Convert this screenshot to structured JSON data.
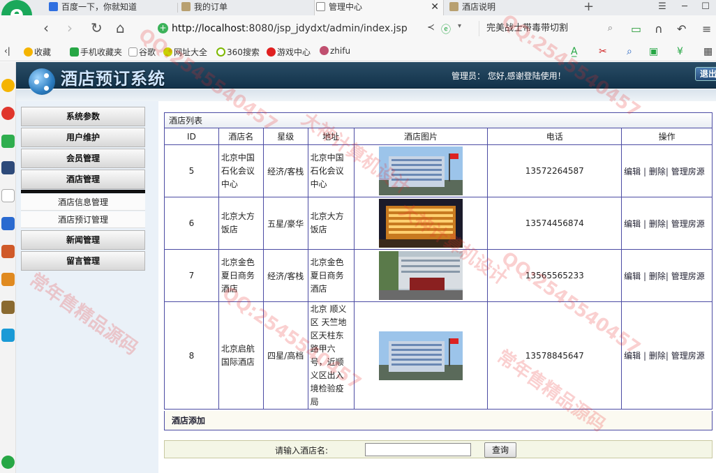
{
  "browser": {
    "tabs": [
      {
        "title": "百度一下，你就知道",
        "active": false
      },
      {
        "title": "我的订单",
        "active": false
      },
      {
        "title": "管理中心",
        "active": true
      },
      {
        "title": "酒店说明",
        "active": false
      }
    ],
    "url_host": "http://localhost",
    "url_rest": ":8080/jsp_jdydxt/admin/index.jsp",
    "search_text": "完美战士带毒带切割",
    "bookmarks": [
      "收藏",
      "手机收藏夹",
      "谷歌",
      "网址大全",
      "360搜索",
      "游戏中心",
      "zhifu"
    ]
  },
  "header": {
    "site_title": "酒店预订系统",
    "admin_msg": "管理员： 您好,感谢登陆使用！",
    "logout_label": "退出"
  },
  "menu": {
    "items": [
      "系统参数",
      "用户维护",
      "会员管理",
      "酒店管理",
      "新闻管理",
      "留言管理"
    ],
    "sub_items": [
      "酒店信息管理",
      "酒店预订管理"
    ]
  },
  "list": {
    "title": "酒店列表",
    "columns": [
      "ID",
      "酒店名",
      "星级",
      "地址",
      "酒店图片",
      "电话",
      "操作"
    ],
    "rows": [
      {
        "id": "5",
        "name": "北京中国石化会议中心",
        "star": "经济/客栈",
        "addr": "北京中国石化会议中心",
        "phone": "13572264587",
        "photo": "building-blue"
      },
      {
        "id": "6",
        "name": "北京大方饭店",
        "star": "五星/豪华",
        "addr": "北京大方饭店",
        "phone": "13574456874",
        "photo": "hotel-night"
      },
      {
        "id": "7",
        "name": "北京金色夏日商务酒店",
        "star": "经济/客栈",
        "addr": "北京金色夏日商务酒店",
        "phone": "13565565233",
        "photo": "hotel-entrance"
      },
      {
        "id": "8",
        "name": "北京启航国际酒店",
        "star": "四星/高档",
        "addr": "北京 顺义区 天竺地区天柱东路甲六号，近顺义区出入境检验疫局",
        "phone": "13578845647",
        "photo": "building-blue"
      }
    ],
    "ops": {
      "edit": "编辑",
      "delete": "删除",
      "rooms": "管理房源"
    },
    "add_label": "酒店添加",
    "search_label": "请输入酒店名:",
    "search_value": "",
    "search_button": "查询"
  },
  "watermark": [
    "QQ:2545540457",
    "大神计算机设计",
    "常年售精品源码"
  ]
}
